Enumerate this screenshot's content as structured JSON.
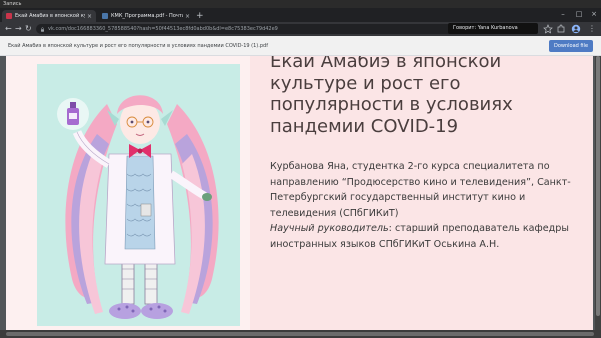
{
  "recording": {
    "label": "Запись"
  },
  "tabs": [
    {
      "title": "Екай Амабиэ в японской культ...",
      "active": true,
      "favicon_color": "#c9354b"
    },
    {
      "title": "КМК_Программа.pdf - Почта М...",
      "active": false,
      "favicon_color": "#4a76a8"
    }
  ],
  "toolbar": {
    "url": "vk.com/doc166883360_578588540?hash=50f44513ec8fd0abd0b&dl=e8c75383ec79d42e9",
    "tooltip": "Говорит: Yana Kurbanova"
  },
  "viewer": {
    "filename": "Екай Амабиэ в японской культуре и рост его популярности в условиях пандемии COVID-19 (1).pdf",
    "download_label": "Download file"
  },
  "slide": {
    "title": "Екай Амабиэ в японской культуре и рост его популярности в условиях пандемии COVID-19",
    "author_line": "Курбанова Яна, студентка 2-го курса специалитета по направлению “Продюсерство кино и телевидения”, Санкт-Петербургский государственный институт кино и телевидения (СПбГИКиТ)",
    "advisor_label": "Научный руководитель",
    "advisor_text": ": старший преподаватель кафедры иностранных языков СПбГИКиТ Оськина А.Н."
  },
  "colors": {
    "slide_bg": "#fbe5e6",
    "illustration_bg": "#c8ece6",
    "hair_pink": "#f4a9c4",
    "hair_purple": "#b9a3dc",
    "accent": "#e1306c"
  }
}
